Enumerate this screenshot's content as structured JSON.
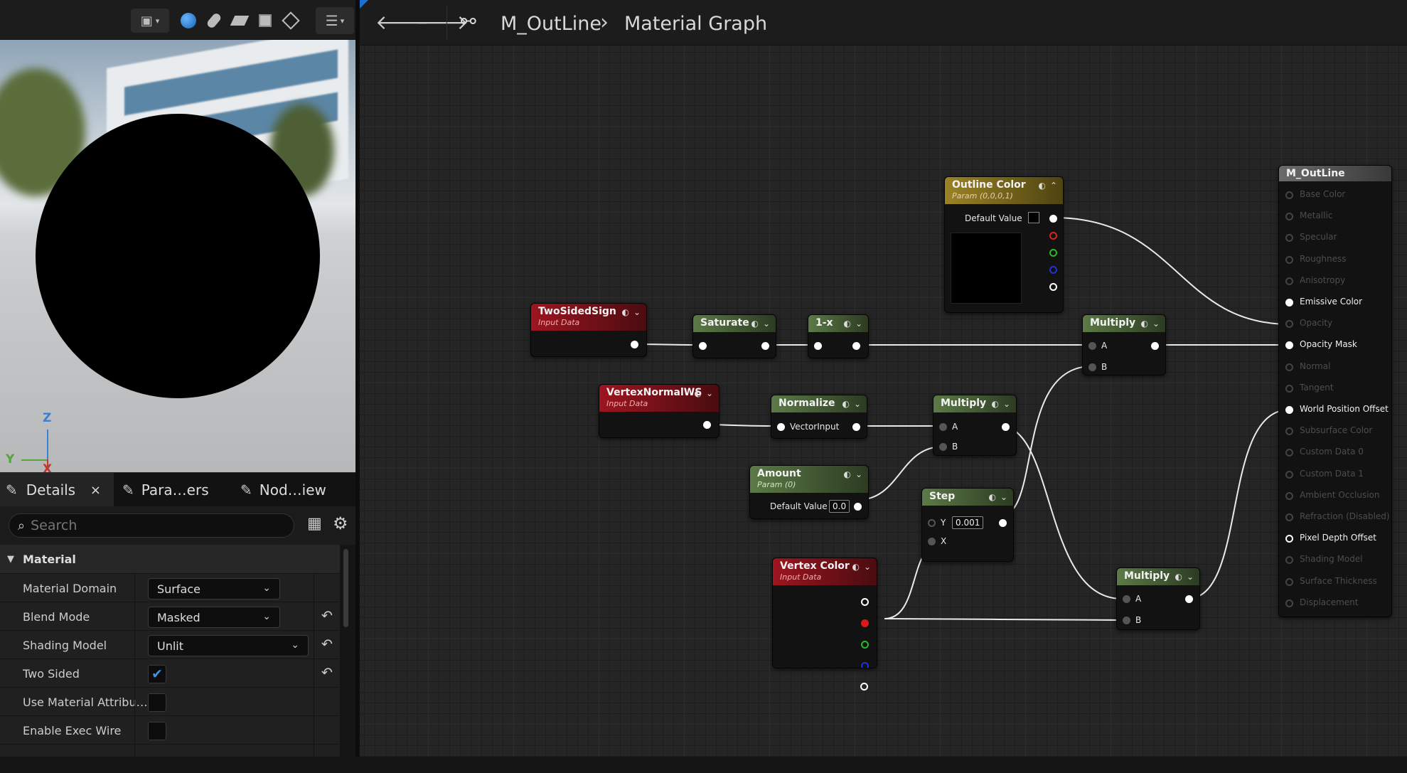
{
  "viewport": {
    "axes": {
      "z": "Z",
      "y": "Y",
      "x": "X"
    },
    "icons": [
      "camera-icon",
      "sphere-preview-icon",
      "cylinder-preview-icon",
      "plane-preview-icon",
      "cube-preview-icon",
      "custom-mesh-icon",
      "hamburger-menu-icon"
    ],
    "colors": {
      "sphere": "#000000",
      "z_axis": "#3d7fd0",
      "y_axis": "#53a53c",
      "x_axis": "#c23a2e"
    }
  },
  "details": {
    "tabs": [
      {
        "label": "Details",
        "icon": "pencil-icon",
        "closable": true
      },
      {
        "label": "Para…ers",
        "icon": "pencil-icon"
      },
      {
        "label": "Nod…iew",
        "icon": "pencil-icon"
      }
    ],
    "search_placeholder": "Search",
    "category": "Material",
    "properties": [
      {
        "label": "Material Domain",
        "value": "Surface",
        "type": "dropdown"
      },
      {
        "label": "Blend Mode",
        "value": "Masked",
        "type": "dropdown",
        "reset": true
      },
      {
        "label": "Shading Model",
        "value": "Unlit",
        "type": "dropdown",
        "reset": true
      },
      {
        "label": "Two Sided",
        "value": "✔",
        "type": "checkbox",
        "checked": true,
        "reset": true
      },
      {
        "label": "Use Material Attribu…",
        "value": "",
        "type": "checkbox",
        "checked": false
      },
      {
        "label": "Enable Exec Wire",
        "value": "",
        "type": "checkbox",
        "checked": false
      }
    ]
  },
  "graph": {
    "breadcrumb": {
      "asset": "M_OutLine",
      "separator": "›",
      "view": "Material Graph"
    },
    "nodes": {
      "two_sided_sign": {
        "title": "TwoSidedSign",
        "subtitle": "Input Data"
      },
      "saturate": {
        "title": "Saturate"
      },
      "one_minus": {
        "title": "1-x"
      },
      "vertex_normal": {
        "title": "VertexNormalWS",
        "subtitle": "Input Data"
      },
      "normalize": {
        "title": "Normalize",
        "input": "VectorInput"
      },
      "amount": {
        "title": "Amount",
        "subtitle": "Param (0)",
        "field_label": "Default Value",
        "value": "0.0"
      },
      "step": {
        "title": "Step",
        "pin_y": "Y",
        "value": "0.001",
        "pin_x": "X"
      },
      "vertex_color": {
        "title": "Vertex Color",
        "subtitle": "Input Data"
      },
      "multiply_top": {
        "title": "Multiply",
        "pin_a": "A",
        "pin_b": "B"
      },
      "multiply_mid": {
        "title": "Multiply",
        "pin_a": "A",
        "pin_b": "B"
      },
      "multiply_bottom": {
        "title": "Multiply",
        "pin_a": "A",
        "pin_b": "B"
      },
      "outline_color": {
        "title": "Outline Color",
        "subtitle": "Param (0,0,0,1)",
        "field_label": "Default Value",
        "swatch": "#000000"
      },
      "result": {
        "title": "M_OutLine",
        "pins": [
          {
            "label": "Base Color",
            "active": false
          },
          {
            "label": "Metallic",
            "active": false
          },
          {
            "label": "Specular",
            "active": false
          },
          {
            "label": "Roughness",
            "active": false
          },
          {
            "label": "Anisotropy",
            "active": false
          },
          {
            "label": "Emissive Color",
            "active": true
          },
          {
            "label": "Opacity",
            "active": false
          },
          {
            "label": "Opacity Mask",
            "active": true
          },
          {
            "label": "Normal",
            "active": false
          },
          {
            "label": "Tangent",
            "active": false
          },
          {
            "label": "World Position Offset",
            "active": true
          },
          {
            "label": "Subsurface Color",
            "active": false
          },
          {
            "label": "Custom Data 0",
            "active": false
          },
          {
            "label": "Custom Data 1",
            "active": false
          },
          {
            "label": "Ambient Occlusion",
            "active": false
          },
          {
            "label": "Refraction (Disabled)",
            "active": false
          },
          {
            "label": "Pixel Depth Offset",
            "active": true,
            "hollow": true
          },
          {
            "label": "Shading Model",
            "active": false
          },
          {
            "label": "Surface Thickness",
            "active": false
          },
          {
            "label": "Displacement",
            "active": false
          }
        ]
      }
    },
    "colors": {
      "input_header": "#9d1520",
      "function_header": "#5c7a47",
      "param_header": "#9b8225",
      "result_header": "#6b6b6b"
    }
  }
}
